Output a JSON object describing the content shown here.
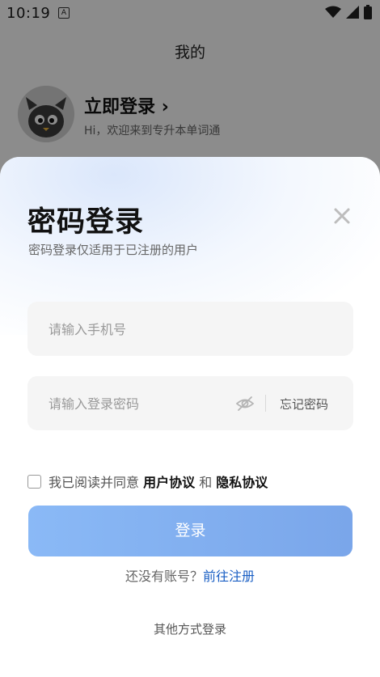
{
  "status_bar": {
    "time": "10:19",
    "notification_badge": "A"
  },
  "background_page": {
    "title": "我的",
    "login_now": "立即登录",
    "chevron": "›",
    "welcome": "Hi，欢迎来到专升本单词通"
  },
  "sheet": {
    "title": "密码登录",
    "subtitle": "密码登录仅适用于已注册的用户",
    "phone_placeholder": "请输入手机号",
    "password_placeholder": "请输入登录密码",
    "forgot_password": "忘记密码",
    "agreement": {
      "prefix": "我已阅读并同意 ",
      "user_agreement": "用户协议",
      "and": " 和 ",
      "privacy_policy": "隐私协议",
      "checked": false
    },
    "login_button": "登录",
    "register_prompt": "还没有账号？",
    "register_link": "前往注册",
    "other_login": "其他方式登录"
  },
  "colors": {
    "accent": "#1a5fc4",
    "button_start": "#8ab9f6",
    "button_end": "#7aa6ea",
    "field_bg": "#f5f5f5"
  },
  "icons": [
    "wifi-icon",
    "signal-icon",
    "battery-icon",
    "close-icon",
    "eye-off-icon",
    "avatar-mascot-icon",
    "chevron-right-icon"
  ]
}
